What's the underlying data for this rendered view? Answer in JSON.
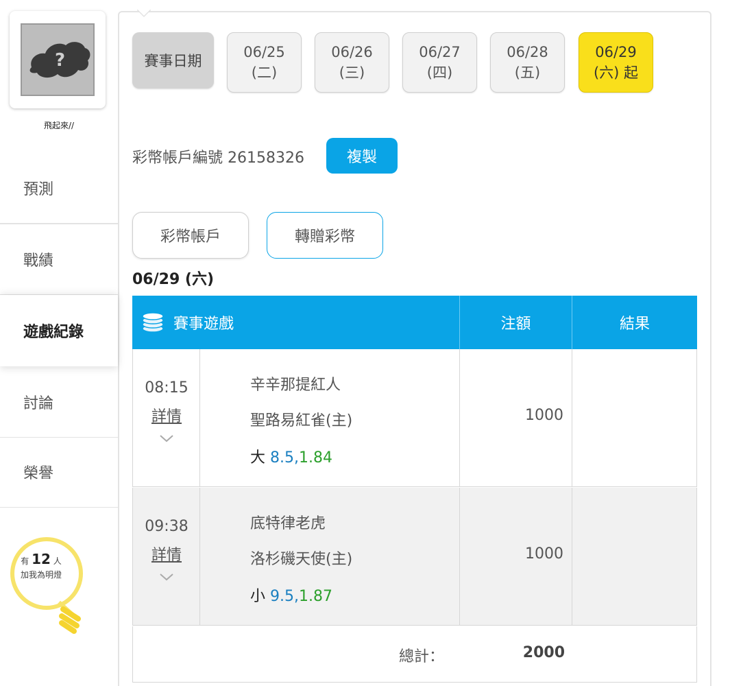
{
  "sidebar": {
    "username": "飛起來//",
    "nav": [
      {
        "label": "預測"
      },
      {
        "label": "戰績"
      },
      {
        "label": "遊戲紀錄"
      },
      {
        "label": "討論"
      },
      {
        "label": "榮譽"
      }
    ],
    "bulb": {
      "prefix": "有",
      "count": "12",
      "suffix": "人",
      "caption": "加我為明燈"
    }
  },
  "dates": {
    "label": "賽事日期",
    "items": [
      {
        "date": "06/25",
        "dow": "(二)"
      },
      {
        "date": "06/26",
        "dow": "(三)"
      },
      {
        "date": "06/27",
        "dow": "(四)"
      },
      {
        "date": "06/28",
        "dow": "(五)"
      },
      {
        "date": "06/29",
        "dow": "(六) 起"
      }
    ]
  },
  "account": {
    "text": "彩幣帳戶編號 26158326",
    "copy_label": "複製"
  },
  "tabs": {
    "account": "彩幣帳戶",
    "transfer": "轉贈彩幣"
  },
  "day_title": "06/29 (六)",
  "table": {
    "headers": {
      "game": "賽事遊戲",
      "amount": "注額",
      "result": "結果"
    },
    "rows": [
      {
        "time": "08:15",
        "detail": "詳情",
        "team1": "辛辛那提紅人",
        "team2": "聖路易紅雀(主)",
        "pick": "大",
        "line": "8.5,",
        "odds": "1.84",
        "amount": "1000",
        "result": ""
      },
      {
        "time": "09:38",
        "detail": "詳情",
        "team1": "底特律老虎",
        "team2": "洛杉磯天使(主)",
        "pick": "小",
        "line": "9.5,",
        "odds": "1.87",
        "amount": "1000",
        "result": ""
      }
    ],
    "total_label": "總計：",
    "total_value": "2000"
  },
  "colors": {
    "accent_blue": "#0aa4e6",
    "active_date_yellow": "#f9df1b",
    "line_blue": "#1a7fc0",
    "odds_green": "#2ca02c"
  }
}
